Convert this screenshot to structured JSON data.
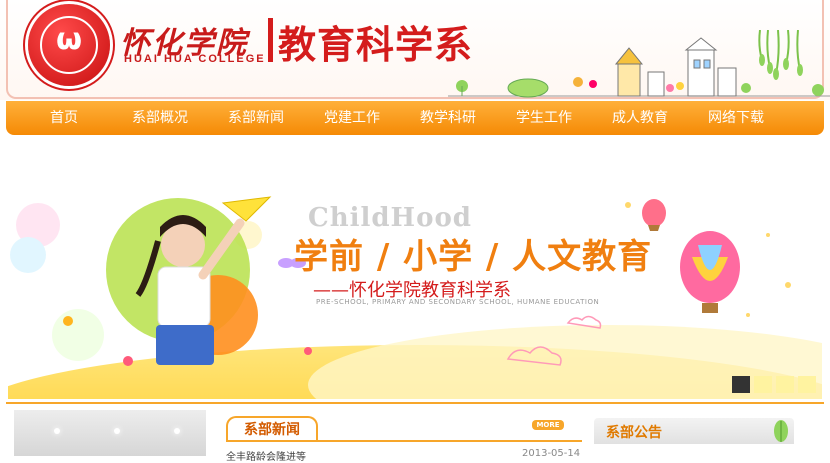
{
  "header": {
    "college_name_cn": "怀化学院",
    "college_name_en": "HUAI HUA COLLEGE",
    "department_title": "教育科学系"
  },
  "nav": {
    "items": [
      "首页",
      "系部概况",
      "系部新闻",
      "党建工作",
      "教学科研",
      "学生工作",
      "成人教育",
      "网络下载"
    ]
  },
  "banner": {
    "watermark": "ChildHood",
    "headline": "学前 / 小学 / 人文教育",
    "subtitle": "——怀化学院教育科学系",
    "subtitle_en": "PRE-SCHOOL, PRIMARY AND SECONDARY SCHOOL, HUMANE EDUCATION",
    "slide_count": 4,
    "active_slide": 1
  },
  "news": {
    "tab_label": "系部新闻",
    "more_label": "MORE",
    "items": [
      {
        "title": "全丰路龄会隆进等",
        "date": "2013-05-14"
      }
    ]
  },
  "notice": {
    "tab_label": "系部公告"
  },
  "colors": {
    "nav_orange": "#f58a05",
    "brand_red": "#d41c1c",
    "accent_yellow": "#ffca1f"
  }
}
